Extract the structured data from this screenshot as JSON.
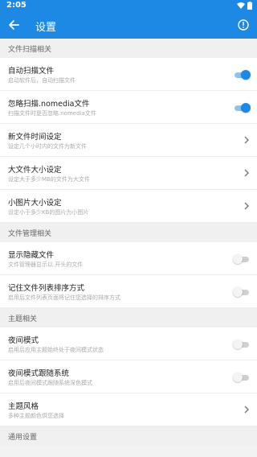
{
  "status_bar": {
    "time": "2:05"
  },
  "app_bar": {
    "title": "设置",
    "back_icon": "arrow-left-icon",
    "info_icon": "info-icon"
  },
  "colors": {
    "accent": "#1e88e5",
    "toggle_off": "#cfcfcf"
  },
  "sections": {
    "file_scan": {
      "header": "文件扫描相关",
      "auto_scan": {
        "title": "自动扫描文件",
        "subtitle": "启动软件后，自动扫描文件",
        "enabled": true
      },
      "ignore_nomedia": {
        "title": "忽略扫描.nomedia文件",
        "subtitle": "扫描文件时是否忽略.nomedia文件",
        "enabled": true
      },
      "new_file_time": {
        "title": "新文件时间设定",
        "subtitle": "设定几个小时内的文件为新文件"
      },
      "large_file_size": {
        "title": "大文件大小设定",
        "subtitle": "设定大于多少MB的文件为大文件"
      },
      "small_image_size": {
        "title": "小图片大小设定",
        "subtitle": "设定小于多少KB的图片为小图片"
      }
    },
    "file_manage": {
      "header": "文件管理相关",
      "show_hidden": {
        "title": "显示隐藏文件",
        "subtitle": "文件管理器显示以.开头的文件",
        "enabled": false
      },
      "remember_sort": {
        "title": "记住文件列表排序方式",
        "subtitle": "启用后文件列表页面将记住您选择的排序方式",
        "enabled": false
      }
    },
    "theme": {
      "header": "主题相关",
      "night_mode": {
        "title": "夜间模式",
        "subtitle": "启用后应用主题始终处于夜间模式状态",
        "enabled": false
      },
      "night_follow_system": {
        "title": "夜间模式跟随系统",
        "subtitle": "启用后夜间模式跟随系统深色模式",
        "enabled": false
      },
      "theme_style": {
        "title": "主题风格",
        "subtitle": "多种主题颜色供您选择"
      }
    },
    "general": {
      "header": "通用设置"
    }
  }
}
